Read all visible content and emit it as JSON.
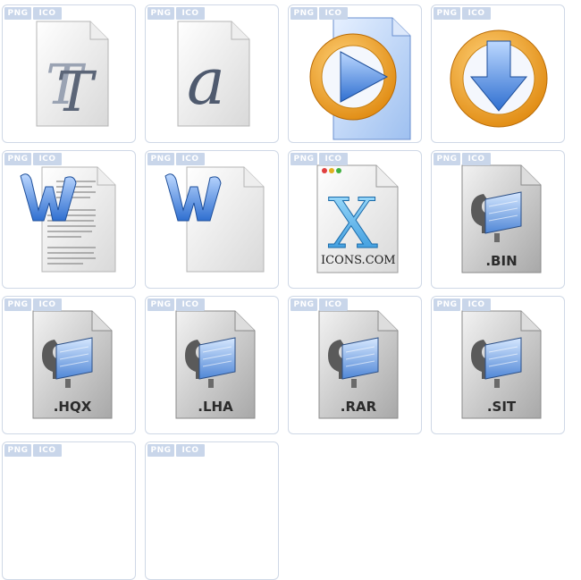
{
  "badges": {
    "png": "PNG",
    "ico": "ICO"
  },
  "tiles": [
    {
      "icon": "font-document-icon",
      "label": ""
    },
    {
      "icon": "font-italic-document-icon",
      "label": ""
    },
    {
      "icon": "media-play-document-icon",
      "label": ""
    },
    {
      "icon": "download-arrow-icon",
      "label": ""
    },
    {
      "icon": "word-text-document-icon",
      "label": ""
    },
    {
      "icon": "word-blank-document-icon",
      "label": ""
    },
    {
      "icon": "x-document-icon",
      "label": "ICONS.COM"
    },
    {
      "icon": "archive-bin-icon",
      "label": ".BIN"
    },
    {
      "icon": "archive-hqx-icon",
      "label": ".HQX"
    },
    {
      "icon": "archive-lha-icon",
      "label": ".LHA"
    },
    {
      "icon": "archive-rar-icon",
      "label": ".RAR"
    },
    {
      "icon": "archive-sit-icon",
      "label": ".SIT"
    },
    {
      "icon": "partial-tile-icon",
      "label": ""
    },
    {
      "icon": "partial-tile-icon",
      "label": ""
    }
  ],
  "colors": {
    "badge": "#c9d6ea",
    "border": "#cfd8e6",
    "accent_orange": "#f0a020",
    "accent_blue": "#2f6fd0"
  }
}
